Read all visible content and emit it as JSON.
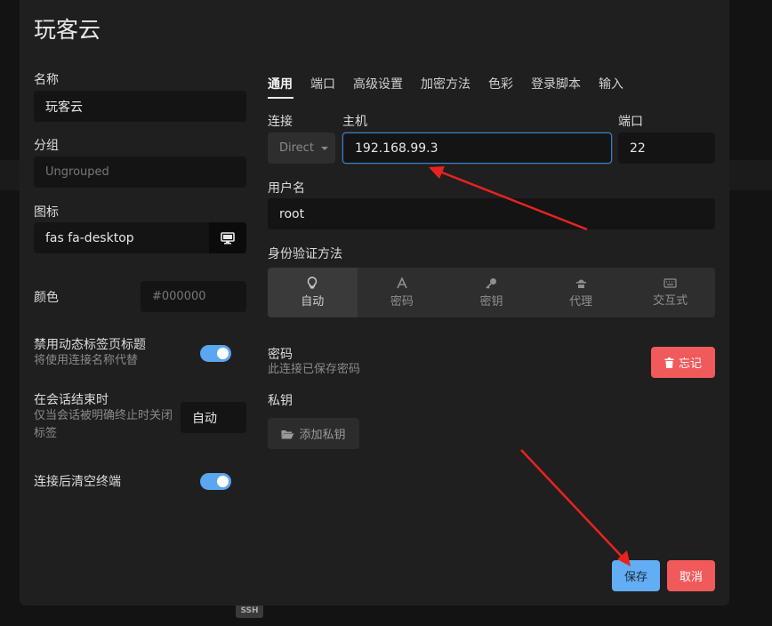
{
  "background": {
    "ssh_badge": "SSH"
  },
  "dialog": {
    "title": "玩客云",
    "left": {
      "name_label": "名称",
      "name_value": "玩客云",
      "group_label": "分组",
      "group_placeholder": "Ungrouped",
      "icon_label": "图标",
      "icon_value": "fas fa-desktop",
      "icon_button_icon": "desktop-icon",
      "color_label": "颜色",
      "color_placeholder": "#000000",
      "disable_dynamic_title_label": "禁用动态标签页标题",
      "disable_dynamic_title_sub": "将使用连接名称代替",
      "disable_dynamic_title_on": true,
      "session_end_label": "在会话结束时",
      "session_end_sub": "仅当会话被明确终止时关闭标签",
      "session_end_value": "自动",
      "clear_terminal_label": "连接后清空终端",
      "clear_terminal_on": true
    },
    "tabs": [
      {
        "label": "通用",
        "active": true
      },
      {
        "label": "端口",
        "active": false
      },
      {
        "label": "高级设置",
        "active": false
      },
      {
        "label": "加密方法",
        "active": false
      },
      {
        "label": "色彩",
        "active": false
      },
      {
        "label": "登录脚本",
        "active": false
      },
      {
        "label": "输入",
        "active": false
      }
    ],
    "general": {
      "connection_label": "连接",
      "connection_value": "Direct",
      "host_label": "主机",
      "host_value": "192.168.99.3",
      "port_label": "端口",
      "port_value": "22",
      "username_label": "用户名",
      "username_value": "root",
      "auth_label": "身份验证方法",
      "auth_methods": [
        {
          "label": "自动",
          "icon": "lightbulb-icon",
          "active": true
        },
        {
          "label": "密码",
          "icon": "font-icon",
          "active": false
        },
        {
          "label": "密钥",
          "icon": "key-icon",
          "active": false
        },
        {
          "label": "代理",
          "icon": "agent-icon",
          "active": false
        },
        {
          "label": "交互式",
          "icon": "keyboard-icon",
          "active": false
        }
      ],
      "password_label": "密码",
      "password_sub": "此连接已保存密码",
      "forget_button": "忘记",
      "forget_icon": "trash-icon",
      "private_key_label": "私钥",
      "add_key_button": "添加私钥",
      "add_key_icon": "folder-open-icon"
    },
    "footer": {
      "save_button": "保存",
      "cancel_button": "取消"
    }
  },
  "colors": {
    "accent": "#62adf3",
    "danger": "#f05a5a",
    "annotation_arrow": "#e8231f"
  }
}
